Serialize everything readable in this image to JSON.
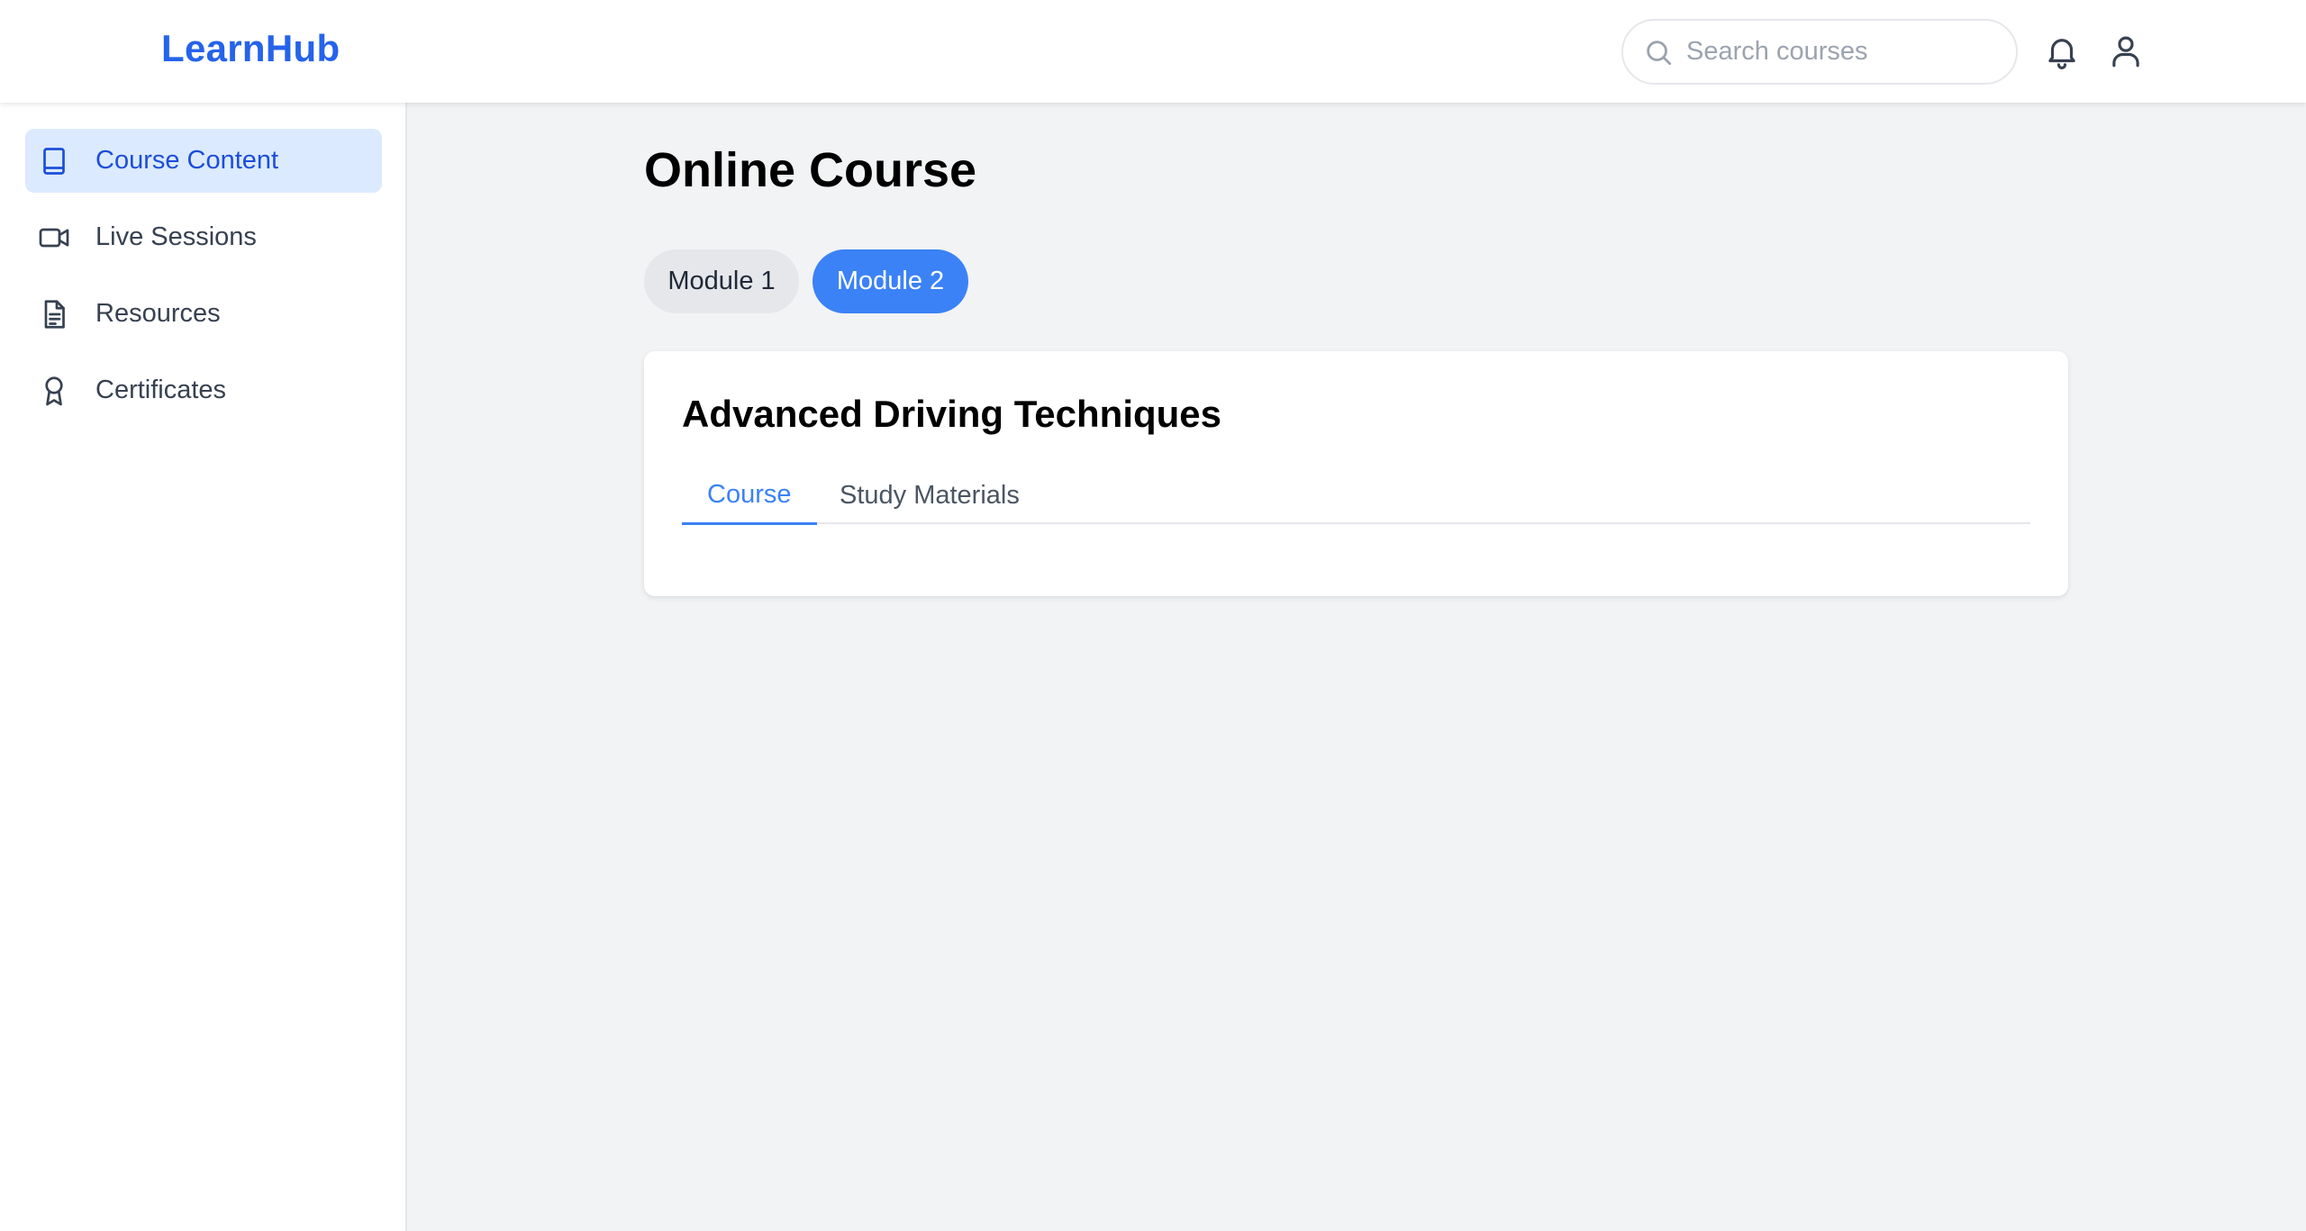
{
  "app": {
    "logo": "LearnHub"
  },
  "header": {
    "search_placeholder": "Search courses",
    "icons": [
      "search-icon",
      "bell-icon",
      "user-icon"
    ]
  },
  "sidebar": {
    "items": [
      {
        "label": "Course Content",
        "icon": "book-icon",
        "active": true
      },
      {
        "label": "Live Sessions",
        "icon": "video-icon",
        "active": false
      },
      {
        "label": "Resources",
        "icon": "document-icon",
        "active": false
      },
      {
        "label": "Certificates",
        "icon": "award-icon",
        "active": false
      }
    ]
  },
  "main": {
    "title": "Online Course",
    "modules": [
      {
        "label": "Module 1",
        "active": false
      },
      {
        "label": "Module 2",
        "active": true
      }
    ],
    "card": {
      "title": "Advanced Driving Techniques",
      "tabs": [
        {
          "label": "Course",
          "active": true
        },
        {
          "label": "Study Materials",
          "active": false
        }
      ]
    }
  },
  "colors": {
    "accent": "#3b82f6",
    "logo": "#2563eb",
    "active_nav_bg": "#dbeafe",
    "page_bg": "#f2f3f5"
  }
}
